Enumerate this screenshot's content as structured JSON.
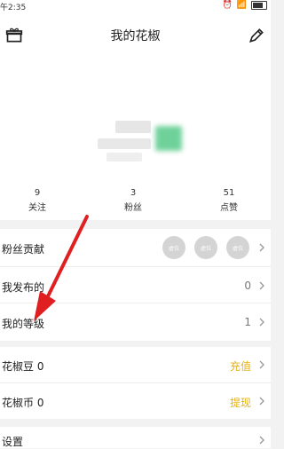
{
  "status_bar": {
    "time": "午2:35"
  },
  "header": {
    "title": "我的花椒"
  },
  "stats": [
    {
      "count": "9",
      "label": "关注"
    },
    {
      "count": "3",
      "label": "粉丝"
    },
    {
      "count": "51",
      "label": "点赞"
    }
  ],
  "menu": {
    "fans": {
      "label": "粉丝贡献",
      "badges": [
        "虚位",
        "虚位",
        "虚位"
      ]
    },
    "posts": {
      "label": "我发布的",
      "value": "0"
    },
    "level": {
      "label": "我的等级",
      "value": "1"
    },
    "beans": {
      "label": "花椒豆 0",
      "action": "充值"
    },
    "coins": {
      "label": "花椒币 0",
      "action": "提现"
    },
    "settings": {
      "label": "设置"
    }
  },
  "colors": {
    "accent": "#e3b218",
    "annotation_arrow": "#e02020"
  },
  "icons": [
    "gift-icon",
    "edit-icon",
    "chevron-right-icon"
  ]
}
